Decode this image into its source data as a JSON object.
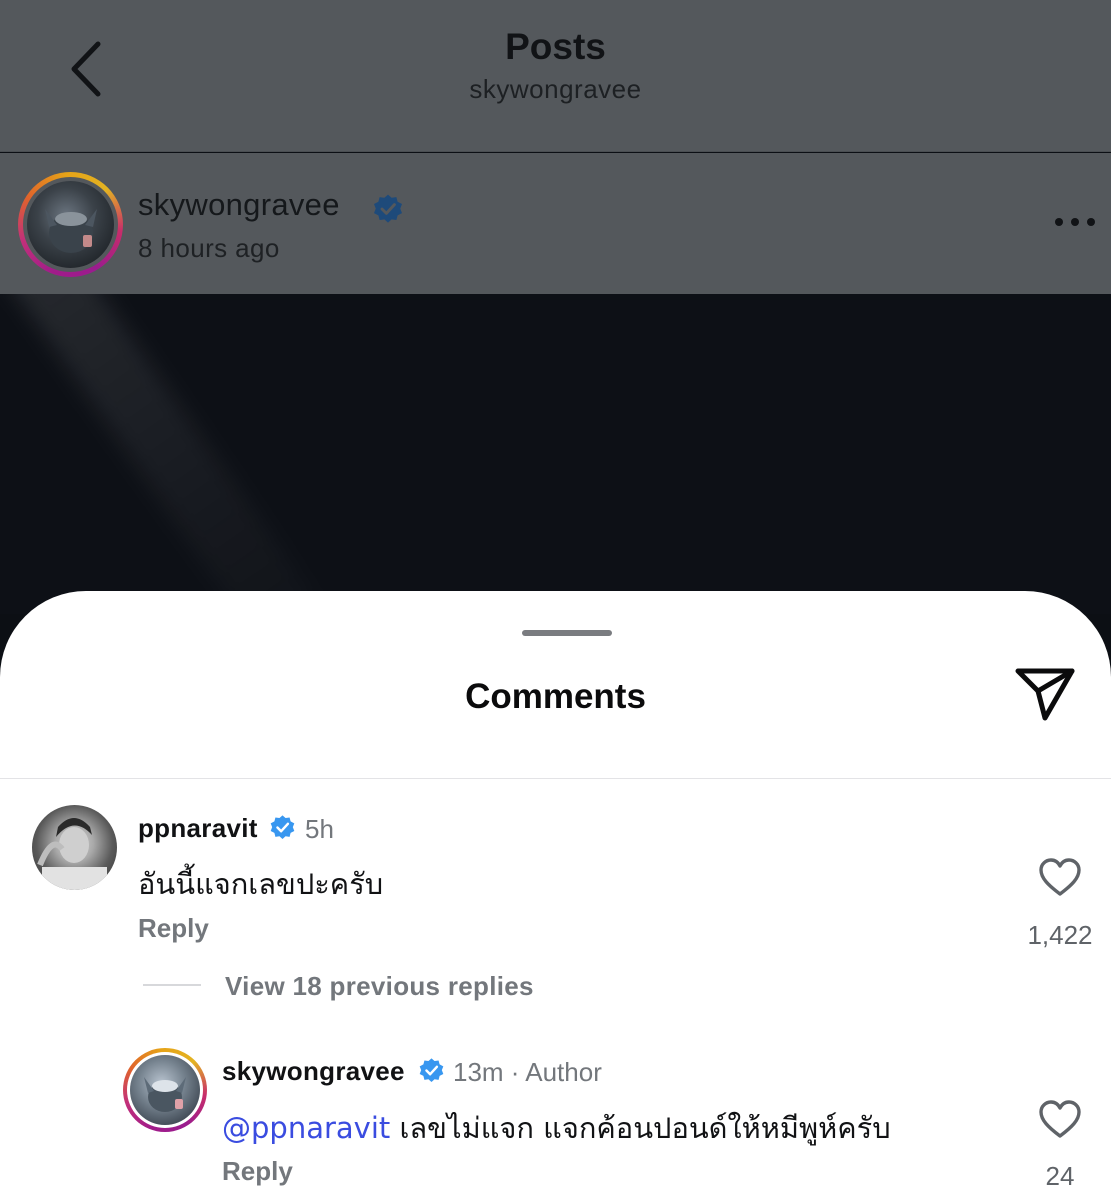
{
  "header": {
    "title": "Posts",
    "subtitle": "skywongravee"
  },
  "post": {
    "username": "skywongravee",
    "time": "8 hours ago"
  },
  "comments_sheet": {
    "title": "Comments",
    "comments": [
      {
        "username": "ppnaravit",
        "time": "5h",
        "text": "อันนี้แจกเลขปะครับ",
        "reply_label": "Reply",
        "likes": "1,422"
      }
    ],
    "view_replies_label": "View 18 previous replies",
    "replies": [
      {
        "username": "skywongravee",
        "time": "13m · Author",
        "mention": "@ppnaravit",
        "text": " เลขไม่แจก แจกค้อนปอนด์ให้หมีพูห์ครับ",
        "reply_label": "Reply",
        "likes": "24"
      }
    ]
  },
  "icons": {
    "back": "chevron-left-icon",
    "verified": "verified-badge-icon",
    "more": "more-horizontal-icon",
    "share": "send-icon",
    "like": "heart-outline-icon"
  },
  "colors": {
    "verified_blue": "#3897f0",
    "mention_blue": "#3a4ce0",
    "dim_overlay": "#54585c"
  }
}
